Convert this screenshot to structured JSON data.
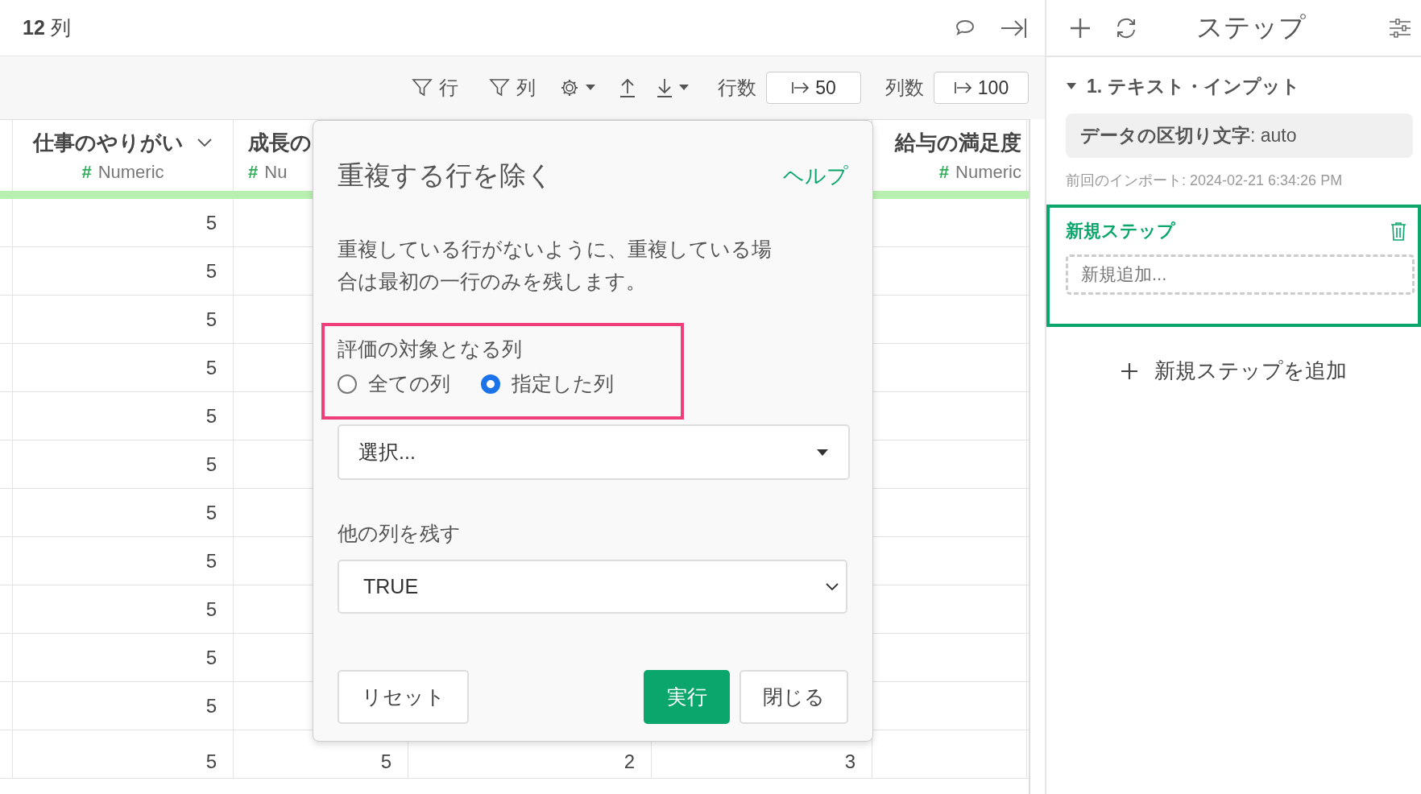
{
  "top_bar": {
    "column_count": "**12** 列"
  },
  "toolbar": {
    "row_filter": "行",
    "column_filter": "列",
    "row_count_label": "行数",
    "row_count": "50",
    "column_count_label": "列数",
    "column_count": "100"
  },
  "table": {
    "columns": [
      {
        "name": "仕事のやりがい",
        "type_mark": "#",
        "type": "Numeric"
      },
      {
        "name": "成長の",
        "type_mark": "#",
        "type": "Nu"
      },
      {},
      {},
      {
        "name": "給与の満足度",
        "type_mark": "#",
        "type": "Numeric"
      }
    ],
    "rows": [
      {
        "cells": [
          "5"
        ]
      },
      {
        "cells": [
          "5"
        ]
      },
      {
        "cells": [
          "5"
        ]
      },
      {
        "cells": [
          "5"
        ]
      },
      {
        "cells": [
          "5"
        ]
      },
      {
        "cells": [
          "5"
        ]
      },
      {
        "cells": [
          "5"
        ]
      },
      {
        "cells": [
          "5"
        ]
      },
      {
        "cells": [
          "5"
        ]
      },
      {
        "cells": [
          "5"
        ]
      },
      {
        "cells": [
          "5"
        ]
      },
      {
        "cells": [
          "5",
          "5",
          "2",
          "3"
        ]
      }
    ]
  },
  "dialog": {
    "title": "重複する行を除く",
    "help": "ヘルプ",
    "description": "重複している行がないように、重複している場合は最初の一行のみを残します。",
    "target_label": "評価の対象となる列",
    "target_options": [
      {
        "label": "全ての列",
        "selected": false
      },
      {
        "label": "指定した列",
        "selected": true
      }
    ],
    "column_select": {
      "placeholder": "選択..."
    },
    "keep_label": "他の列を残す",
    "keep_value": "TRUE",
    "buttons": {
      "reset": "リセット",
      "run": "実行",
      "close": "閉じる"
    }
  },
  "steps_panel": {
    "title": "ステップ",
    "steps": [
      {
        "title": "1. テキスト・インプット",
        "expanded": true,
        "parameter": "**データの区切り文字**: auto",
        "timestamp": "前回のインポート: 2024-02-21 6:34:26 PM"
      }
    ],
    "new_step": {
      "title": "新規ステップ",
      "placeholder": "新規追加..."
    },
    "add_step": "新規ステップを追加"
  }
}
